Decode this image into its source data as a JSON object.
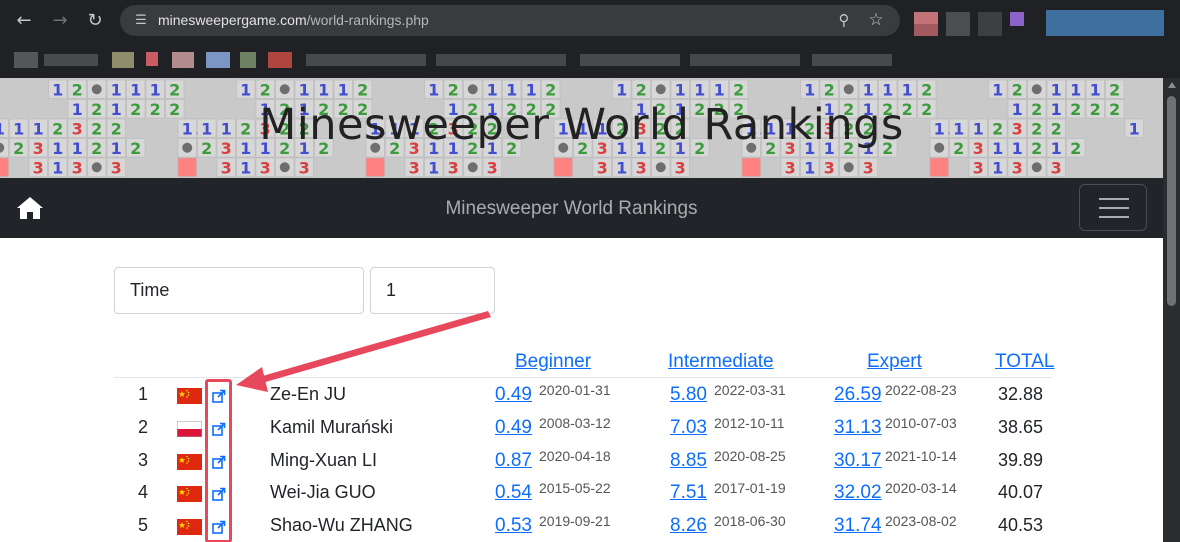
{
  "browser": {
    "url_host": "minesweepergame.com",
    "url_path": "/world-rankings.php",
    "back_icon": "arrow-left-icon",
    "forward_icon": "arrow-right-icon",
    "reload_icon": "reload-icon"
  },
  "banner": {
    "title": "Minesweeper World Rankings"
  },
  "navbar": {
    "brand": "Minesweeper World Rankings"
  },
  "controls": {
    "sort_value": "Time",
    "page_value": "1"
  },
  "table": {
    "headers": {
      "beginner": "Beginner",
      "intermediate": "Intermediate",
      "expert": "Expert",
      "total": "TOTAL"
    },
    "rows": [
      {
        "rank": "1",
        "flag": "china",
        "name": "Ze-En JU",
        "beg": "0.49",
        "beg_date": "2020-01-31",
        "int": "5.80",
        "int_date": "2022-03-31",
        "exp": "26.59",
        "exp_date": "2022-08-23",
        "total": "32.88"
      },
      {
        "rank": "2",
        "flag": "poland",
        "name": "Kamil Murański",
        "beg": "0.49",
        "beg_date": "2008-03-12",
        "int": "7.03",
        "int_date": "2012-10-11",
        "exp": "31.13",
        "exp_date": "2010-07-03",
        "total": "38.65"
      },
      {
        "rank": "3",
        "flag": "china",
        "name": "Ming-Xuan LI",
        "beg": "0.87",
        "beg_date": "2020-04-18",
        "int": "8.85",
        "int_date": "2020-08-25",
        "exp": "30.17",
        "exp_date": "2021-10-14",
        "total": "39.89"
      },
      {
        "rank": "4",
        "flag": "china",
        "name": "Wei-Jia GUO",
        "beg": "0.54",
        "beg_date": "2015-05-22",
        "int": "7.51",
        "int_date": "2017-01-19",
        "exp": "32.02",
        "exp_date": "2020-03-14",
        "total": "40.07"
      },
      {
        "rank": "5",
        "flag": "china",
        "name": "Shao-Wu ZHANG",
        "beg": "0.53",
        "beg_date": "2019-09-21",
        "int": "8.26",
        "int_date": "2018-06-30",
        "exp": "31.74",
        "exp_date": "2023-08-02",
        "total": "40.53"
      }
    ]
  },
  "colors": {
    "link": "#0d6efd",
    "navbar": "#212529",
    "annotation": "#e8485c"
  }
}
